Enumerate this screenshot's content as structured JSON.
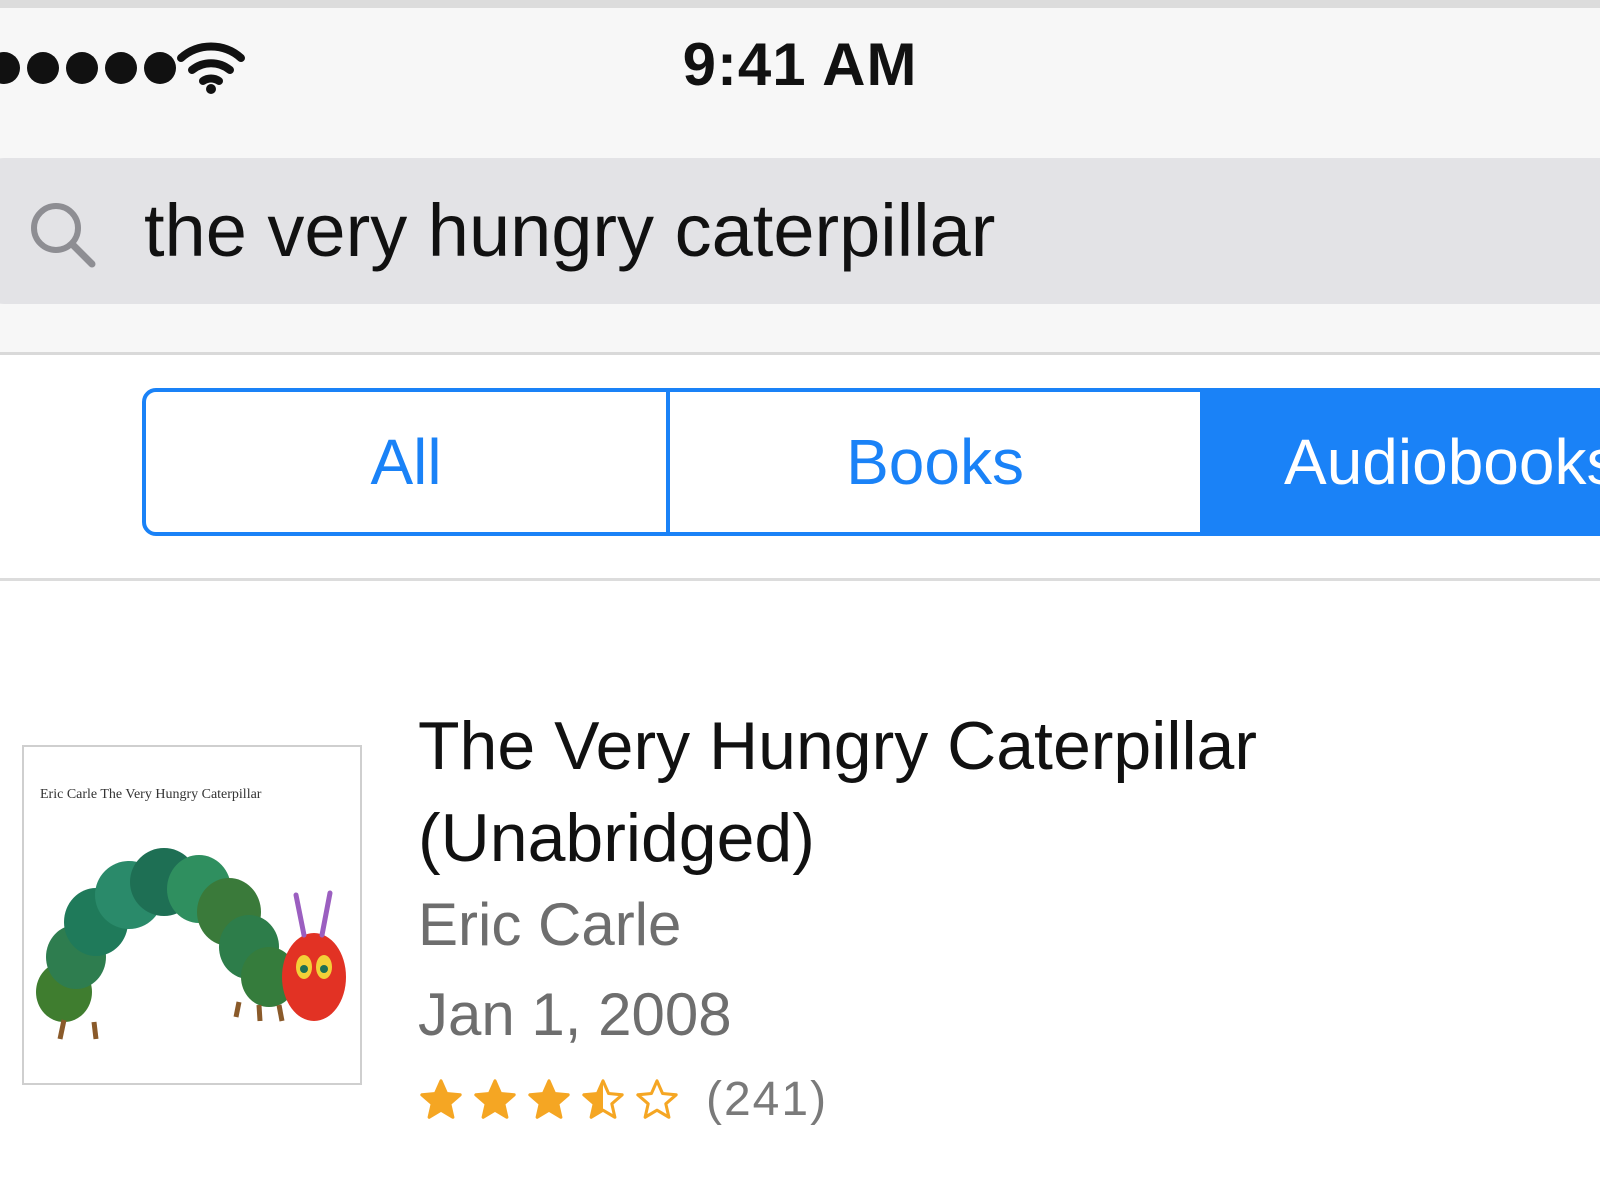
{
  "status_bar": {
    "time": "9:41 AM",
    "signal_icon": "cellular-signal-icon",
    "wifi_icon": "wifi-icon"
  },
  "search": {
    "icon": "search-icon",
    "query": "the very hungry caterpillar"
  },
  "segments": [
    {
      "label": "All",
      "selected": false
    },
    {
      "label": "Books",
      "selected": false
    },
    {
      "label": "Audiobooks",
      "selected": true
    }
  ],
  "result": {
    "cover_caption": "Eric Carle    The Very Hungry Caterpillar",
    "title": "The Very Hungry Caterpillar (Unabridged)",
    "author": "Eric Carle",
    "date": "Jan 1, 2008",
    "rating": 3.5,
    "rating_max": 5,
    "rating_count": "(241)"
  },
  "colors": {
    "accent": "#1a82f7",
    "star": "#f5a623",
    "secondary_text": "#6e6e6e"
  }
}
